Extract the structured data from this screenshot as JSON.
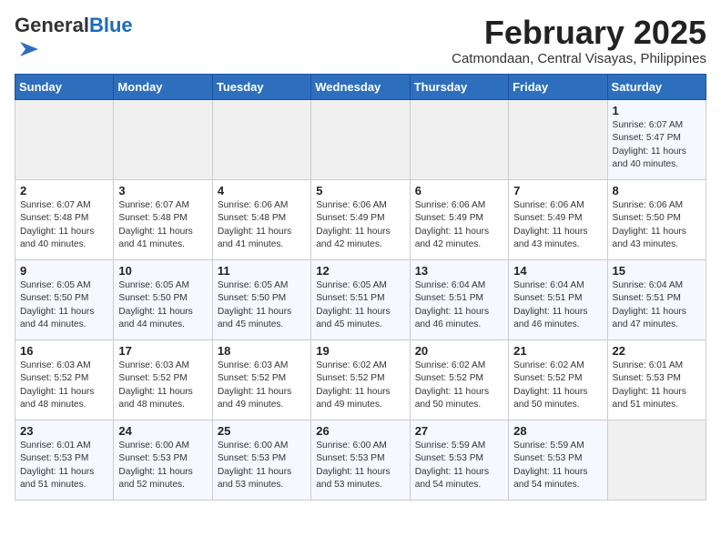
{
  "header": {
    "logo_general": "General",
    "logo_blue": "Blue",
    "month_title": "February 2025",
    "location": "Catmondaan, Central Visayas, Philippines"
  },
  "days_of_week": [
    "Sunday",
    "Monday",
    "Tuesday",
    "Wednesday",
    "Thursday",
    "Friday",
    "Saturday"
  ],
  "weeks": [
    [
      {
        "day": "",
        "info": ""
      },
      {
        "day": "",
        "info": ""
      },
      {
        "day": "",
        "info": ""
      },
      {
        "day": "",
        "info": ""
      },
      {
        "day": "",
        "info": ""
      },
      {
        "day": "",
        "info": ""
      },
      {
        "day": "1",
        "info": "Sunrise: 6:07 AM\nSunset: 5:47 PM\nDaylight: 11 hours\nand 40 minutes."
      }
    ],
    [
      {
        "day": "2",
        "info": "Sunrise: 6:07 AM\nSunset: 5:48 PM\nDaylight: 11 hours\nand 40 minutes."
      },
      {
        "day": "3",
        "info": "Sunrise: 6:07 AM\nSunset: 5:48 PM\nDaylight: 11 hours\nand 41 minutes."
      },
      {
        "day": "4",
        "info": "Sunrise: 6:06 AM\nSunset: 5:48 PM\nDaylight: 11 hours\nand 41 minutes."
      },
      {
        "day": "5",
        "info": "Sunrise: 6:06 AM\nSunset: 5:49 PM\nDaylight: 11 hours\nand 42 minutes."
      },
      {
        "day": "6",
        "info": "Sunrise: 6:06 AM\nSunset: 5:49 PM\nDaylight: 11 hours\nand 42 minutes."
      },
      {
        "day": "7",
        "info": "Sunrise: 6:06 AM\nSunset: 5:49 PM\nDaylight: 11 hours\nand 43 minutes."
      },
      {
        "day": "8",
        "info": "Sunrise: 6:06 AM\nSunset: 5:50 PM\nDaylight: 11 hours\nand 43 minutes."
      }
    ],
    [
      {
        "day": "9",
        "info": "Sunrise: 6:05 AM\nSunset: 5:50 PM\nDaylight: 11 hours\nand 44 minutes."
      },
      {
        "day": "10",
        "info": "Sunrise: 6:05 AM\nSunset: 5:50 PM\nDaylight: 11 hours\nand 44 minutes."
      },
      {
        "day": "11",
        "info": "Sunrise: 6:05 AM\nSunset: 5:50 PM\nDaylight: 11 hours\nand 45 minutes."
      },
      {
        "day": "12",
        "info": "Sunrise: 6:05 AM\nSunset: 5:51 PM\nDaylight: 11 hours\nand 45 minutes."
      },
      {
        "day": "13",
        "info": "Sunrise: 6:04 AM\nSunset: 5:51 PM\nDaylight: 11 hours\nand 46 minutes."
      },
      {
        "day": "14",
        "info": "Sunrise: 6:04 AM\nSunset: 5:51 PM\nDaylight: 11 hours\nand 46 minutes."
      },
      {
        "day": "15",
        "info": "Sunrise: 6:04 AM\nSunset: 5:51 PM\nDaylight: 11 hours\nand 47 minutes."
      }
    ],
    [
      {
        "day": "16",
        "info": "Sunrise: 6:03 AM\nSunset: 5:52 PM\nDaylight: 11 hours\nand 48 minutes."
      },
      {
        "day": "17",
        "info": "Sunrise: 6:03 AM\nSunset: 5:52 PM\nDaylight: 11 hours\nand 48 minutes."
      },
      {
        "day": "18",
        "info": "Sunrise: 6:03 AM\nSunset: 5:52 PM\nDaylight: 11 hours\nand 49 minutes."
      },
      {
        "day": "19",
        "info": "Sunrise: 6:02 AM\nSunset: 5:52 PM\nDaylight: 11 hours\nand 49 minutes."
      },
      {
        "day": "20",
        "info": "Sunrise: 6:02 AM\nSunset: 5:52 PM\nDaylight: 11 hours\nand 50 minutes."
      },
      {
        "day": "21",
        "info": "Sunrise: 6:02 AM\nSunset: 5:52 PM\nDaylight: 11 hours\nand 50 minutes."
      },
      {
        "day": "22",
        "info": "Sunrise: 6:01 AM\nSunset: 5:53 PM\nDaylight: 11 hours\nand 51 minutes."
      }
    ],
    [
      {
        "day": "23",
        "info": "Sunrise: 6:01 AM\nSunset: 5:53 PM\nDaylight: 11 hours\nand 51 minutes."
      },
      {
        "day": "24",
        "info": "Sunrise: 6:00 AM\nSunset: 5:53 PM\nDaylight: 11 hours\nand 52 minutes."
      },
      {
        "day": "25",
        "info": "Sunrise: 6:00 AM\nSunset: 5:53 PM\nDaylight: 11 hours\nand 53 minutes."
      },
      {
        "day": "26",
        "info": "Sunrise: 6:00 AM\nSunset: 5:53 PM\nDaylight: 11 hours\nand 53 minutes."
      },
      {
        "day": "27",
        "info": "Sunrise: 5:59 AM\nSunset: 5:53 PM\nDaylight: 11 hours\nand 54 minutes."
      },
      {
        "day": "28",
        "info": "Sunrise: 5:59 AM\nSunset: 5:53 PM\nDaylight: 11 hours\nand 54 minutes."
      },
      {
        "day": "",
        "info": ""
      }
    ]
  ]
}
